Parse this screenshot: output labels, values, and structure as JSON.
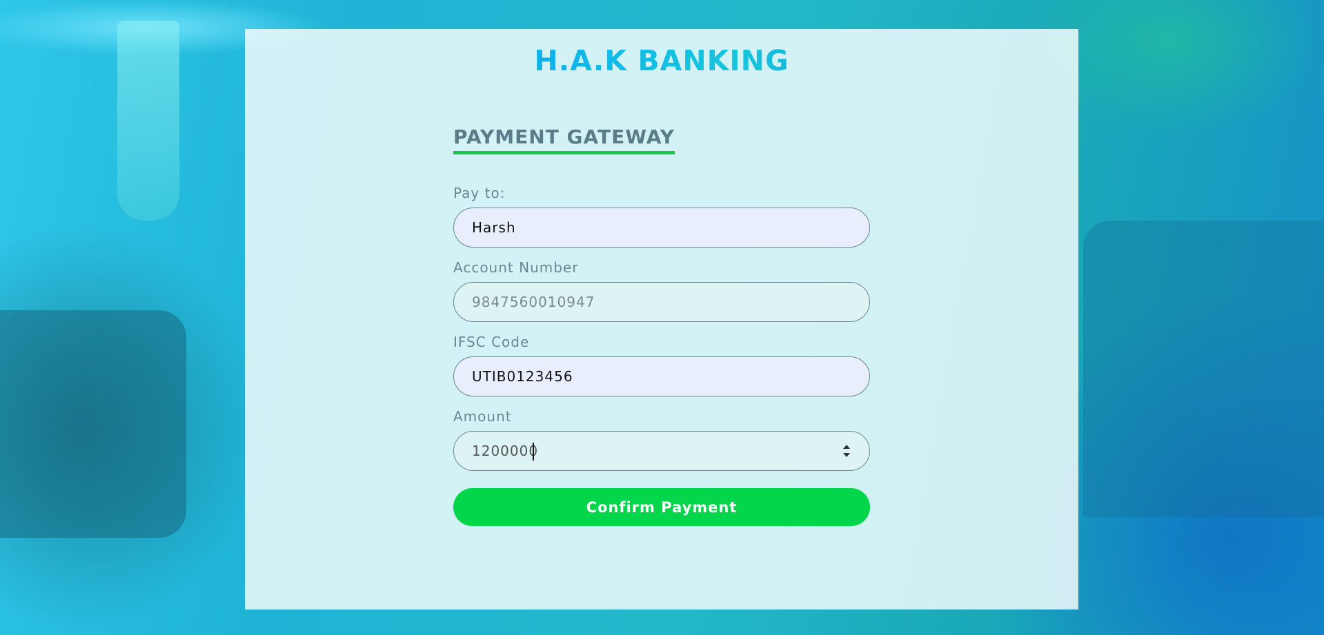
{
  "brand": {
    "name": "H.A.K BANKING"
  },
  "form": {
    "heading": "PAYMENT GATEWAY",
    "fields": [
      {
        "label": "Pay to:",
        "value": "Harsh",
        "placeholder": ""
      },
      {
        "label": "Account Number",
        "value": "",
        "placeholder": "9847560010947"
      },
      {
        "label": "IFSC Code",
        "value": "UTIB0123456",
        "placeholder": ""
      },
      {
        "label": "Amount",
        "value": "1200000",
        "placeholder": ""
      }
    ],
    "submit_label": "Confirm Payment"
  },
  "colors": {
    "accent_green": "#03d64a",
    "heading_underline": "#20c64a",
    "brand_blue": "#0a7fe6",
    "brand_cyan": "#11b7e8",
    "autofill_bg": "#e8eefb"
  },
  "icons": {
    "amount_spinner": "number-spinner-icon"
  }
}
